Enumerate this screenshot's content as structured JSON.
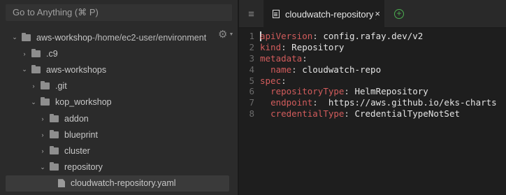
{
  "search": {
    "placeholder": "Go to Anything (⌘ P)"
  },
  "tree": {
    "root": {
      "name": "aws-workshop",
      "separator": " - ",
      "path": "/home/ec2-user/environment"
    },
    "items": [
      {
        "name": ".c9"
      },
      {
        "name": "aws-workshops"
      },
      {
        "name": ".git"
      },
      {
        "name": "kop_workshop"
      },
      {
        "name": "addon"
      },
      {
        "name": "blueprint"
      },
      {
        "name": "cluster"
      },
      {
        "name": "repository"
      },
      {
        "name": "cloudwatch-repository.yaml"
      }
    ]
  },
  "editor": {
    "tab_title": "cloudwatch-repository.yaml",
    "tab_close": "×",
    "add_tab": "+",
    "lines": [
      {
        "num": "1",
        "key": "apiVersion",
        "colon": ":",
        "value": " config.rafay.dev/v2"
      },
      {
        "num": "2",
        "key": "kind",
        "colon": ":",
        "value": " Repository"
      },
      {
        "num": "3",
        "key": "metadata",
        "colon": ":",
        "value": ""
      },
      {
        "num": "4",
        "key": "name",
        "colon": ":",
        "value": " cloudwatch-repo"
      },
      {
        "num": "5",
        "key": "spec",
        "colon": ":",
        "value": ""
      },
      {
        "num": "6",
        "key": "repositoryType",
        "colon": ":",
        "value": " HelmRepository"
      },
      {
        "num": "7",
        "key": "endpoint",
        "colon": ":",
        "value": "  https://aws.github.io/eks-charts"
      },
      {
        "num": "8",
        "key": "credentialType",
        "colon": ":",
        "value": " CredentialTypeNotSet"
      }
    ]
  },
  "colors": {
    "yaml_key": "#d25c5c",
    "add_tab": "#4caf50",
    "selected_row": "#3a3a3a"
  },
  "icons": {
    "gear": "gear-icon",
    "menu": "menu-icon",
    "file": "file-icon",
    "folder": "folder-icon"
  }
}
